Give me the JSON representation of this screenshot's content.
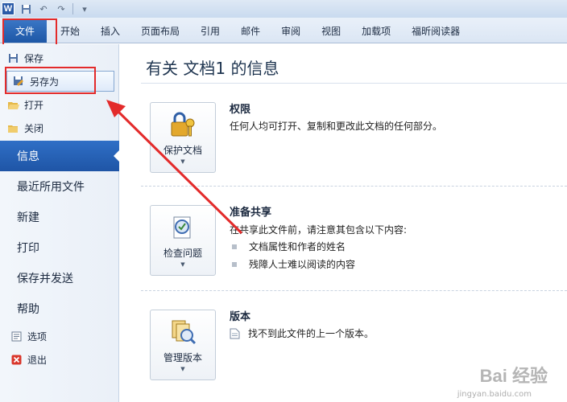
{
  "quick_access": {
    "word_icon": "W",
    "save_icon": "save-icon",
    "undo_icon": "undo-icon",
    "redo_icon": "redo-icon"
  },
  "tabs": [
    {
      "label": "文件"
    },
    {
      "label": "开始"
    },
    {
      "label": "插入"
    },
    {
      "label": "页面布局"
    },
    {
      "label": "引用"
    },
    {
      "label": "邮件"
    },
    {
      "label": "审阅"
    },
    {
      "label": "视图"
    },
    {
      "label": "加载项"
    },
    {
      "label": "福昕阅读器"
    }
  ],
  "backstage": {
    "commands": [
      {
        "label": "保存",
        "icon": "save-icon"
      },
      {
        "label": "另存为",
        "icon": "save-as-icon"
      },
      {
        "label": "打开",
        "icon": "open-folder-icon"
      },
      {
        "label": "关闭",
        "icon": "close-folder-icon"
      }
    ],
    "nav": [
      {
        "label": "信息"
      },
      {
        "label": "最近所用文件"
      },
      {
        "label": "新建"
      },
      {
        "label": "打印"
      },
      {
        "label": "保存并发送"
      },
      {
        "label": "帮助"
      }
    ],
    "footer": [
      {
        "label": "选项",
        "icon": "options-icon"
      },
      {
        "label": "退出",
        "icon": "exit-icon"
      }
    ]
  },
  "info": {
    "title": "有关 文档1 的信息",
    "permissions": {
      "button": "保护文档",
      "heading": "权限",
      "text": "任何人均可打开、复制和更改此文档的任何部分。"
    },
    "prepare": {
      "button": "检查问题",
      "heading": "准备共享",
      "text": "在共享此文件前，请注意其包含以下内容:",
      "bullets": [
        "文档属性和作者的姓名",
        "残障人士难以阅读的内容"
      ]
    },
    "versions": {
      "button": "管理版本",
      "heading": "版本",
      "text": "找不到此文件的上一个版本。"
    }
  },
  "colors": {
    "accent": "#1f55a6",
    "highlight": "#e32b2b"
  },
  "watermark": {
    "brand": "Bai 经验",
    "url": "jingyan.baidu.com"
  }
}
